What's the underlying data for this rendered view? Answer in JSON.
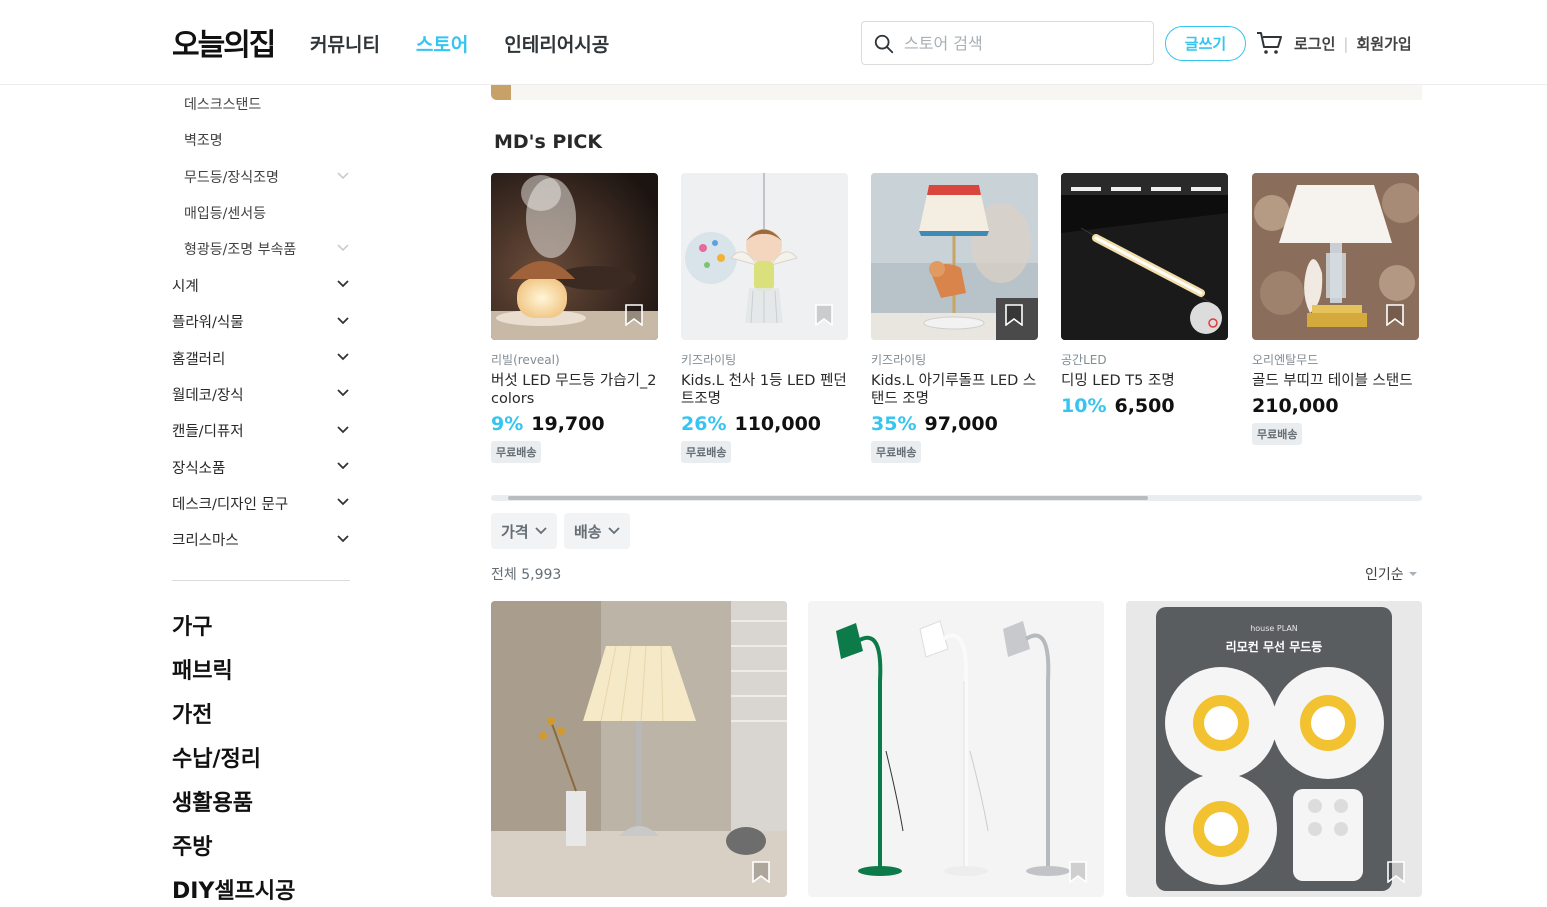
{
  "header": {
    "logo": "오늘의집",
    "nav": [
      "커뮤니티",
      "스토어",
      "인테리어시공"
    ],
    "nav_active": "스토어",
    "search_placeholder": "스토어 검색",
    "write_label": "글쓰기",
    "login_label": "로그인",
    "separator": "|",
    "signup_label": "회원가입"
  },
  "sidebar": {
    "sub_items": [
      {
        "label": "데스크스탠드",
        "chevron": false
      },
      {
        "label": "벽조명",
        "chevron": false
      },
      {
        "label": "무드등/장식조명",
        "chevron": true
      },
      {
        "label": "매입등/센서등",
        "chevron": false
      },
      {
        "label": "형광등/조명 부속품",
        "chevron": true
      }
    ],
    "categories": [
      "시계",
      "플라워/식물",
      "홈갤러리",
      "월데코/장식",
      "캔들/디퓨저",
      "장식소품",
      "데스크/디자인 문구",
      "크리스마스"
    ],
    "big_categories": [
      "가구",
      "패브릭",
      "가전",
      "수납/정리",
      "생활용품",
      "주방",
      "DIY셀프시공"
    ]
  },
  "md_pick": {
    "title": "MD's PICK",
    "items": [
      {
        "brand": "리빌(reveal)",
        "name": "버섯 LED 무드등 가습기_2colors",
        "discount": "9%",
        "price": "19,700",
        "badge": "무료배송"
      },
      {
        "brand": "키즈라이팅",
        "name": "Kids.L 천사 1등 LED 펜던트조명",
        "discount": "26%",
        "price": "110,000",
        "badge": "무료배송"
      },
      {
        "brand": "키즈라이팅",
        "name": "Kids.L 아기루돌프 LED 스탠드 조명",
        "discount": "35%",
        "price": "97,000",
        "badge": "무료배송"
      },
      {
        "brand": "공간LED",
        "name": "디밍 LED T5 조명",
        "discount": "10%",
        "price": "6,500",
        "badge": ""
      },
      {
        "brand": "오리엔탈무드",
        "name": "골드 부띠끄 테이블 스탠드",
        "discount": "",
        "price": "210,000",
        "badge": "무료배송"
      }
    ]
  },
  "filters": [
    "가격",
    "배송"
  ],
  "total_label": "전체 5,993",
  "sort_label": "인기순",
  "product_images": {
    "p3_brand": "house PLAN",
    "p3_title": "리모컨 무선 무드등"
  },
  "colors": {
    "accent": "#35c5f0",
    "text": "#292929",
    "muted": "#828c94"
  }
}
